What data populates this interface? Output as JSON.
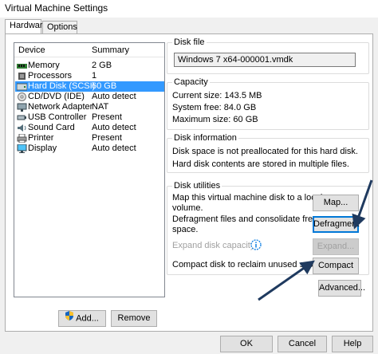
{
  "window": {
    "title": "Virtual Machine Settings"
  },
  "tabs": [
    {
      "label": "Hardware"
    },
    {
      "label": "Options"
    }
  ],
  "device_list": {
    "headers": {
      "device": "Device",
      "summary": "Summary"
    },
    "rows": [
      {
        "icon": "memory-icon",
        "name": "Memory",
        "summary": "2 GB"
      },
      {
        "icon": "processor-icon",
        "name": "Processors",
        "summary": "1"
      },
      {
        "icon": "hard-disk-icon",
        "name": "Hard Disk (SCSI)",
        "summary": "60 GB",
        "selected": true
      },
      {
        "icon": "cd-dvd-icon",
        "name": "CD/DVD (IDE)",
        "summary": "Auto detect"
      },
      {
        "icon": "network-adapter-icon",
        "name": "Network Adapter",
        "summary": "NAT"
      },
      {
        "icon": "usb-icon",
        "name": "USB Controller",
        "summary": "Present"
      },
      {
        "icon": "sound-card-icon",
        "name": "Sound Card",
        "summary": "Auto detect"
      },
      {
        "icon": "printer-icon",
        "name": "Printer",
        "summary": "Present"
      },
      {
        "icon": "display-icon",
        "name": "Display",
        "summary": "Auto detect"
      }
    ]
  },
  "buttons": {
    "add": "Add...",
    "remove": "Remove",
    "ok": "OK",
    "cancel": "Cancel",
    "help": "Help"
  },
  "disk_file": {
    "group_label": "Disk file",
    "value": "Windows 7 x64-000001.vmdk"
  },
  "capacity": {
    "group_label": "Capacity",
    "current_size": "Current size:  143.5 MB",
    "system_free": "System free:  84.0 GB",
    "maximum_size": "Maximum size:  60 GB"
  },
  "disk_information": {
    "group_label": "Disk information",
    "line1": "Disk space is not preallocated for this hard disk.",
    "line2": "Hard disk contents are stored in multiple files."
  },
  "disk_utilities": {
    "group_label": "Disk utilities",
    "map_text_1": "Map this virtual machine disk to a local",
    "map_text_2": "volume.",
    "map_button": "Map...",
    "defrag_text_1": "Defragment files and consolidate free",
    "defrag_text_2": "space.",
    "defrag_button": "Defragment",
    "expand_text": "Expand disk capacity.",
    "expand_button": "Expand...",
    "compact_text": "Compact disk to reclaim unused space.",
    "compact_button": "Compact"
  },
  "advanced_button": "Advanced...",
  "colors": {
    "selection": "#3399ff",
    "arrow": "#1f3a5f",
    "focus": "#0078d7"
  }
}
